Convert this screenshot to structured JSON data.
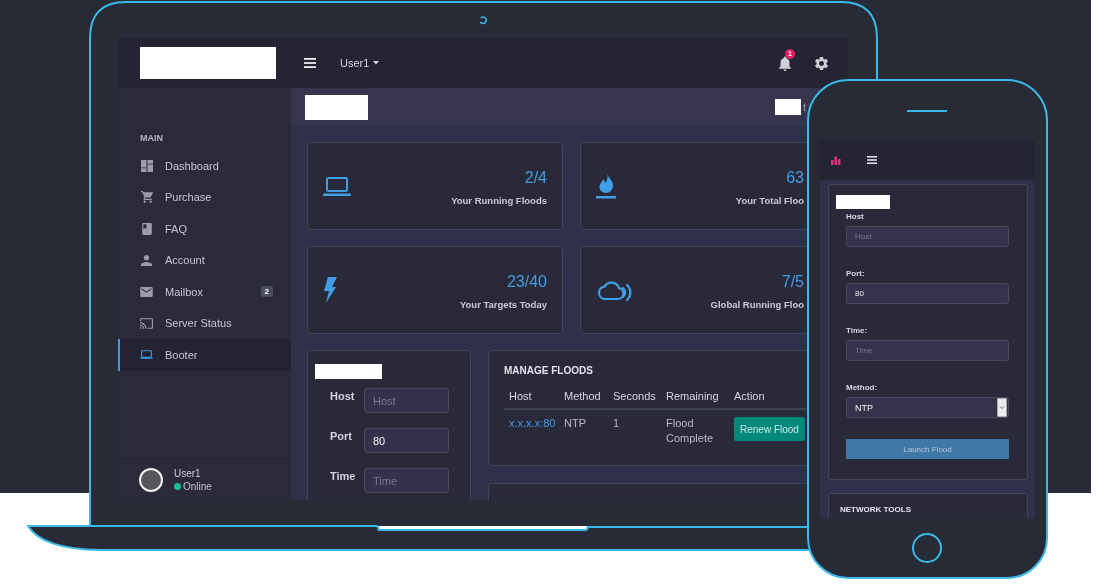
{
  "laptop": {
    "header": {
      "user_menu": "User1",
      "notification_count": "1"
    },
    "sidebar": {
      "section_title": "MAIN",
      "items": [
        {
          "label": "Dashboard",
          "selected": false
        },
        {
          "label": "Purchase",
          "selected": false
        },
        {
          "label": "FAQ",
          "selected": false
        },
        {
          "label": "Account",
          "selected": false
        },
        {
          "label": "Mailbox",
          "badge": "2",
          "selected": false
        },
        {
          "label": "Server Status",
          "selected": false
        },
        {
          "label": "Booter",
          "selected": true
        }
      ],
      "user": {
        "name": "User1",
        "status": "Online"
      }
    },
    "page_header": {
      "breadcrumb": "t"
    },
    "stats": [
      {
        "value": "2/4",
        "label": "Your Running Floods"
      },
      {
        "value": "63",
        "label": "Your Total Floo"
      },
      {
        "value": "23/40",
        "label": "Your Targets Today"
      },
      {
        "value": "7/5",
        "label": "Global Running Floo"
      }
    ],
    "flood_form": {
      "fields": [
        {
          "label": "Host",
          "placeholder": "Host"
        },
        {
          "label": "Port",
          "value": "80"
        },
        {
          "label": "Time",
          "placeholder": "Time"
        }
      ]
    },
    "manage_floods": {
      "title": "MANAGE FLOODS",
      "columns": [
        "Host",
        "Method",
        "Seconds",
        "Remaining",
        "Action"
      ],
      "rows": [
        {
          "host": "x.x.x.x:80",
          "method": "NTP",
          "seconds": "1",
          "remaining": "Flood Complete",
          "action": "Renew Flood"
        }
      ]
    }
  },
  "phone": {
    "form": {
      "fields": [
        {
          "kind": "input",
          "label": "Host",
          "placeholder": "Host"
        },
        {
          "kind": "input",
          "label": "Port:",
          "value": "80"
        },
        {
          "kind": "input",
          "label": "Time:",
          "placeholder": "Time"
        },
        {
          "kind": "select",
          "label": "Method:",
          "value": "NTP"
        }
      ],
      "submit": "Launch Flood"
    },
    "next_panel": {
      "title": "NETWORK TOOLS"
    }
  }
}
